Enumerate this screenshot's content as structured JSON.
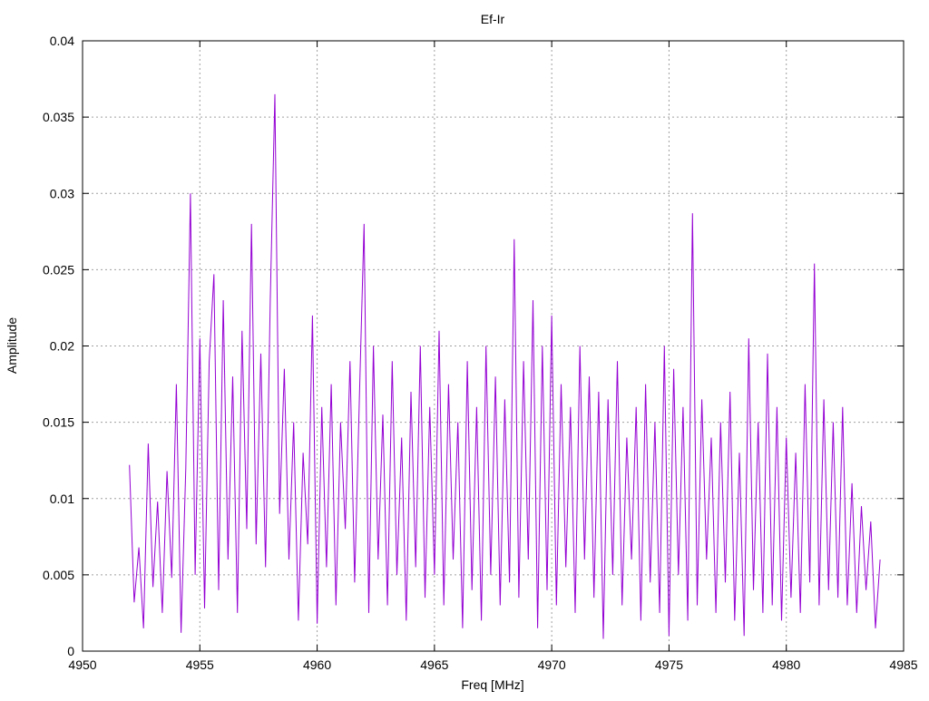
{
  "chart_data": {
    "type": "line",
    "title": "Ef-Ir",
    "xlabel": "Freq [MHz]",
    "ylabel": "Amplitude",
    "xlim": [
      4950,
      4985
    ],
    "ylim": [
      0,
      0.04
    ],
    "xticks": [
      4950,
      4955,
      4960,
      4965,
      4970,
      4975,
      4980,
      4985
    ],
    "xtick_labels": [
      "4950",
      "4955",
      "4960",
      "4965",
      "4970",
      "4975",
      "4980",
      "4985"
    ],
    "yticks": [
      0,
      0.005,
      0.01,
      0.015,
      0.02,
      0.025,
      0.03,
      0.035,
      0.04
    ],
    "ytick_labels": [
      "0",
      "0.005",
      "0.01",
      "0.015",
      "0.02",
      "0.025",
      "0.03",
      "0.035",
      "0.04"
    ],
    "grid": true,
    "legend": "none",
    "series_color": "#9400d3",
    "x_start": 4952.0,
    "x_step": 0.2,
    "values": [
      0.0122,
      0.0032,
      0.0068,
      0.0015,
      0.0136,
      0.0042,
      0.0098,
      0.0025,
      0.0118,
      0.0048,
      0.0175,
      0.0012,
      0.012,
      0.03,
      0.005,
      0.0205,
      0.0028,
      0.019,
      0.0247,
      0.004,
      0.023,
      0.006,
      0.018,
      0.0025,
      0.021,
      0.008,
      0.028,
      0.007,
      0.0195,
      0.0055,
      0.023,
      0.0365,
      0.009,
      0.0185,
      0.006,
      0.015,
      0.002,
      0.013,
      0.007,
      0.022,
      0.0018,
      0.016,
      0.0055,
      0.0175,
      0.003,
      0.015,
      0.008,
      0.019,
      0.0045,
      0.0165,
      0.028,
      0.0025,
      0.02,
      0.006,
      0.0155,
      0.003,
      0.019,
      0.005,
      0.014,
      0.002,
      0.017,
      0.0055,
      0.02,
      0.0035,
      0.016,
      0.005,
      0.021,
      0.003,
      0.0175,
      0.006,
      0.015,
      0.0015,
      0.019,
      0.004,
      0.016,
      0.002,
      0.02,
      0.005,
      0.018,
      0.003,
      0.0165,
      0.0045,
      0.027,
      0.0035,
      0.019,
      0.006,
      0.023,
      0.0015,
      0.02,
      0.004,
      0.022,
      0.003,
      0.0175,
      0.0055,
      0.016,
      0.0025,
      0.02,
      0.006,
      0.018,
      0.0035,
      0.017,
      0.0008,
      0.0165,
      0.005,
      0.019,
      0.003,
      0.014,
      0.006,
      0.016,
      0.002,
      0.0175,
      0.0045,
      0.015,
      0.0025,
      0.02,
      0.001,
      0.0185,
      0.005,
      0.016,
      0.002,
      0.0287,
      0.003,
      0.0165,
      0.006,
      0.014,
      0.0025,
      0.015,
      0.0045,
      0.017,
      0.002,
      0.013,
      0.001,
      0.0205,
      0.004,
      0.015,
      0.0025,
      0.0195,
      0.003,
      0.016,
      0.002,
      0.014,
      0.0035,
      0.013,
      0.0025,
      0.0175,
      0.0045,
      0.0254,
      0.003,
      0.0165,
      0.004,
      0.015,
      0.0035,
      0.016,
      0.003,
      0.011,
      0.0025,
      0.0095,
      0.004,
      0.0085,
      0.0015,
      0.006
    ]
  }
}
